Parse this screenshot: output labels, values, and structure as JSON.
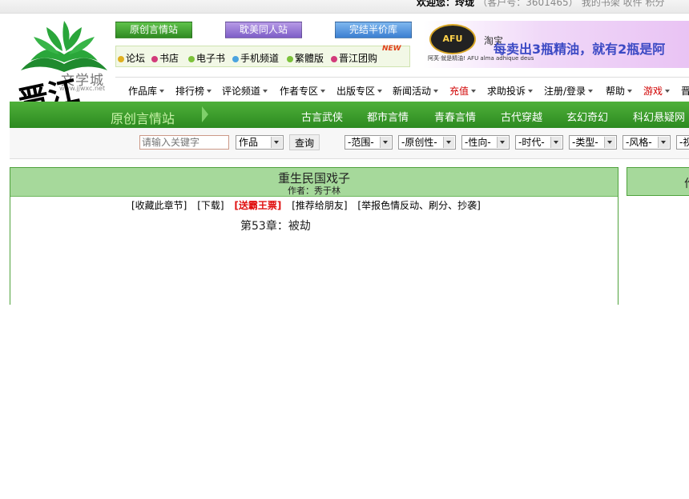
{
  "topbar": {
    "welcome": "欢迎您：玲珑",
    "user_id": "（客户号：3601465）",
    "links": "我的书架  收件  积分"
  },
  "logo": {
    "text": "文学城",
    "url": "www.jjwxc.net",
    "calligraphy": "晋江"
  },
  "site_buttons": [
    "原创言情站",
    "耽美同人站",
    "完结半价库"
  ],
  "quick_links": [
    {
      "label": "论坛",
      "color": "#e0b020"
    },
    {
      "label": "书店",
      "color": "#d23b7a"
    },
    {
      "label": "电子书",
      "color": "#7cc23a"
    },
    {
      "label": "手机频道",
      "color": "#4aa3df"
    },
    {
      "label": "繁體版",
      "color": "#7cc23a"
    },
    {
      "label": "晋江团购",
      "color": "#d23b7a"
    }
  ],
  "new_badge": "NEW",
  "ad": {
    "logo": "AFU",
    "logo_sub": "阿芙·就是精油! AFU alma adhique deus",
    "taobao": "淘宝",
    "text": "每卖出3瓶精油，就有2瓶是阿"
  },
  "main_nav": [
    "作品库",
    "排行榜",
    "评论频道",
    "作者专区",
    "出版专区",
    "新闻活动",
    "充值",
    "求助投诉",
    "注册/登录",
    "帮助",
    "游戏",
    "晋"
  ],
  "green_bar": {
    "title": "原创言情站",
    "categories": [
      "古言武侠",
      "都市言情",
      "青春言情",
      "古代穿越",
      "玄幻奇幻",
      "科幻悬疑网"
    ]
  },
  "search": {
    "placeholder": "请输入关键字",
    "type": "作品",
    "button": "查询",
    "filters": [
      "-范围-",
      "-原创性-",
      "-性向-",
      "-时代-",
      "-类型-",
      "-风格-",
      "-视"
    ]
  },
  "book": {
    "title": "重生民国戏子",
    "author": "作者：秀于林",
    "actions": [
      "[收藏此章节]",
      "[下载]",
      "[送霸王票]",
      "[推荐给朋友]",
      "[举报色情反动、刷分、抄袭]"
    ],
    "chapter": "第53章：被劫"
  },
  "side_panel": {
    "text": "作"
  },
  "colors": {
    "green": "#2c8a20",
    "panel": "#a6d99b",
    "red": "#e01010"
  }
}
